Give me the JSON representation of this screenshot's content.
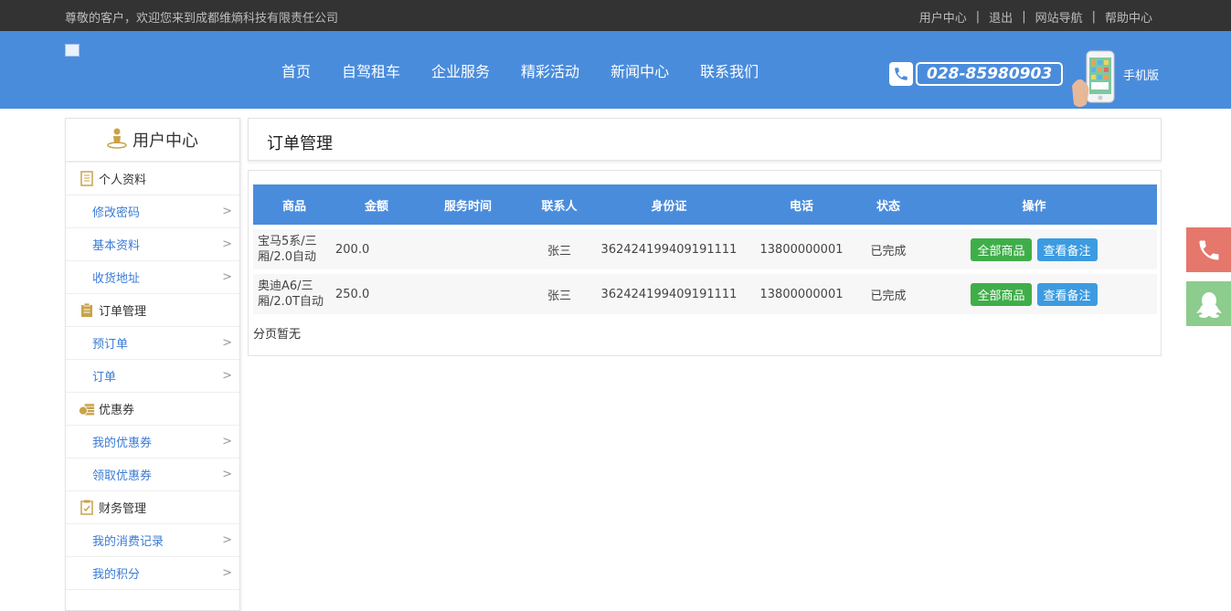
{
  "topbar": {
    "welcome": "尊敬的客户，欢迎您来到成都维熵科技有限责任公司",
    "links": [
      "用户中心",
      "退出",
      "网站导航",
      "帮助中心"
    ],
    "separator": "|"
  },
  "header": {
    "nav": [
      "首页",
      "自驾租车",
      "企业服务",
      "精彩活动",
      "新闻中心",
      "联系我们"
    ],
    "hotline": "028-85980903",
    "mobile_label": "手机版"
  },
  "sidebar": {
    "title": "用户中心",
    "groups": [
      {
        "label": "个人资料",
        "items": [
          "修改密码",
          "基本资料",
          "收货地址"
        ]
      },
      {
        "label": "订单管理",
        "items": [
          "预订单",
          "订单"
        ]
      },
      {
        "label": "优惠券",
        "items": [
          "我的优惠券",
          "领取优惠券"
        ]
      },
      {
        "label": "财务管理",
        "items": [
          "我的消费记录",
          "我的积分"
        ]
      }
    ],
    "chevron": ">"
  },
  "main": {
    "title": "订单管理",
    "table": {
      "headers": [
        "商品",
        "金额",
        "服务时间",
        "联系人",
        "身份证",
        "电话",
        "状态",
        "操作"
      ],
      "rows": [
        {
          "product": "宝马5系/三厢/2.0自动",
          "amount": "200.0",
          "service_time": "",
          "contact": "张三",
          "id_card": "362424199409191111",
          "phone": "13800000001",
          "status": "已完成"
        },
        {
          "product": "奥迪A6/三厢/2.0T自动",
          "amount": "250.0",
          "service_time": "",
          "contact": "张三",
          "id_card": "362424199409191111",
          "phone": "13800000001",
          "status": "已完成"
        }
      ],
      "action_all": "全部商品",
      "action_note": "查看备注"
    },
    "pager": "分页暂无"
  },
  "colors": {
    "header_blue": "#4a8cdc",
    "topbar_dark": "#333333",
    "btn_green": "#3fae49",
    "btn_blue": "#3c9be0",
    "float_red": "#e5776c",
    "float_green": "#8ccc8d",
    "sidebar_gold": "#c9a24a"
  }
}
